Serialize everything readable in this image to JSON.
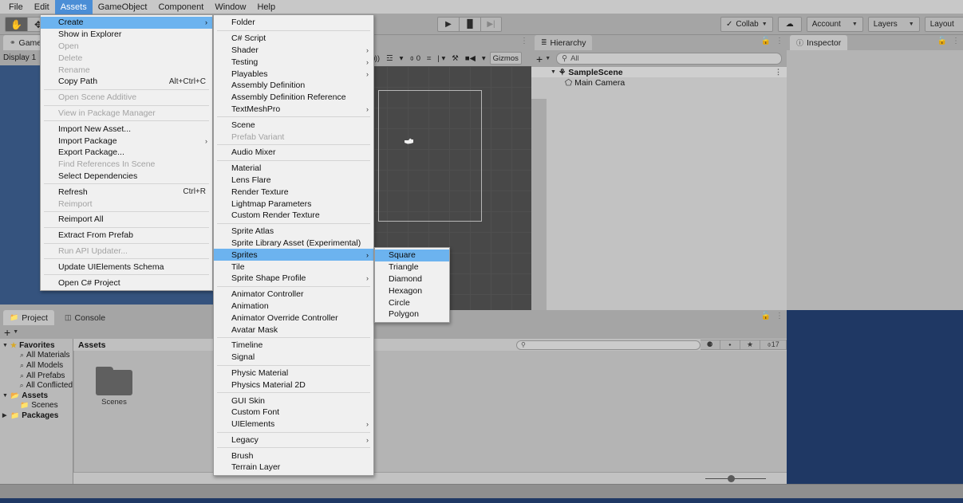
{
  "menubar": {
    "items": [
      {
        "label": "File",
        "active": false
      },
      {
        "label": "Edit",
        "active": false
      },
      {
        "label": "Assets",
        "active": true
      },
      {
        "label": "GameObject",
        "active": false
      },
      {
        "label": "Component",
        "active": false
      },
      {
        "label": "Window",
        "active": false
      },
      {
        "label": "Help",
        "active": false
      }
    ]
  },
  "toolbar": {
    "tools": [
      {
        "name": "hand-tool",
        "glyph": "✋"
      },
      {
        "name": "move-tool",
        "glyph": "✥"
      }
    ],
    "play_controls": [
      {
        "name": "play-button",
        "glyph": "▶"
      },
      {
        "name": "pause-button",
        "glyph": "▐▌"
      },
      {
        "name": "step-button",
        "glyph": "▶|"
      }
    ],
    "collab_label": "Collab",
    "cloud_icon": "cloud-icon",
    "account_label": "Account",
    "layers_label": "Layers",
    "layout_label": "Layout"
  },
  "game_view": {
    "tab_label": "Game",
    "tab_icon": "game-icon",
    "display_label": "Display 1",
    "canvas_color": "#35537e"
  },
  "scene_view": {
    "tools": [
      {
        "name": "audio-toggle-icon",
        "label": "◂))"
      },
      {
        "name": "fx-lighting-icon",
        "label": "☲"
      },
      {
        "name": "fx-dropdown-caret",
        "label": "▾"
      },
      {
        "name": "gizmo-visibility-icon",
        "label": "⌽ 0"
      },
      {
        "name": "grid-icon",
        "label": "⌗"
      },
      {
        "name": "grid-caret",
        "label": "| ▾"
      },
      {
        "name": "scene-tools-icon",
        "label": "⚒"
      },
      {
        "name": "camera-icon",
        "label": "■◀"
      },
      {
        "name": "camera-caret",
        "label": "▾"
      },
      {
        "name": "gizmos-button",
        "label": "Gizmos"
      }
    ]
  },
  "hierarchy": {
    "tab_label": "Hierarchy",
    "tab_icon": "hierarchy-icon",
    "add_button": "+",
    "search_placeholder": "All",
    "search_icon": "search-icon",
    "tree": [
      {
        "label": "SampleScene",
        "type": "scene",
        "expanded": true,
        "icon": "scene-icon"
      },
      {
        "label": "Main Camera",
        "type": "gameobject",
        "icon": "gameobject-icon"
      }
    ]
  },
  "inspector": {
    "tab_label": "Inspector",
    "tab_icon": "info-icon"
  },
  "project": {
    "tabs": [
      {
        "label": "Project",
        "icon": "folder-icon",
        "active": true
      },
      {
        "label": "Console",
        "icon": "console-icon",
        "active": false
      }
    ],
    "add_button": "+",
    "tree": [
      {
        "label": "Favorites",
        "icon": "star-icon",
        "bold": true,
        "indent": 0,
        "arrow": "▼"
      },
      {
        "label": "All Materials",
        "icon": "search-icon",
        "bold": false,
        "indent": 1,
        "arrow": ""
      },
      {
        "label": "All Models",
        "icon": "search-icon",
        "bold": false,
        "indent": 1,
        "arrow": ""
      },
      {
        "label": "All Prefabs",
        "icon": "search-icon",
        "bold": false,
        "indent": 1,
        "arrow": ""
      },
      {
        "label": "All Conflicted",
        "icon": "search-icon",
        "bold": false,
        "indent": 1,
        "arrow": ""
      },
      {
        "label": "Assets",
        "icon": "folder-open-icon",
        "bold": true,
        "indent": 0,
        "arrow": "▼"
      },
      {
        "label": "Scenes",
        "icon": "folder-icon",
        "bold": false,
        "indent": 1,
        "arrow": ""
      },
      {
        "label": "Packages",
        "icon": "folder-icon",
        "bold": true,
        "indent": 0,
        "arrow": "▶"
      }
    ],
    "breadcrumb": "Assets",
    "search_placeholder": "",
    "search_icon": "search-icon",
    "filter_buttons": [
      {
        "name": "filter-by-type-icon",
        "label": "⚈"
      },
      {
        "name": "filter-by-label-icon",
        "label": "⬩"
      },
      {
        "name": "filter-favorite-icon",
        "label": "★"
      },
      {
        "name": "hidden-packages-count",
        "label": "⌽17"
      }
    ],
    "assets": [
      {
        "label": "Scenes",
        "type": "folder"
      }
    ],
    "zoom_value": 37
  },
  "menu_assets": {
    "title": "Assets",
    "items": [
      {
        "label": "Create",
        "selected": true,
        "submenu": true
      },
      {
        "label": "Show in Explorer"
      },
      {
        "label": "Open",
        "disabled": true
      },
      {
        "label": "Delete",
        "disabled": true
      },
      {
        "label": "Rename",
        "disabled": true
      },
      {
        "label": "Copy Path",
        "shortcut": "Alt+Ctrl+C"
      },
      {
        "separator": true
      },
      {
        "label": "Open Scene Additive",
        "disabled": true
      },
      {
        "separator": true
      },
      {
        "label": "View in Package Manager",
        "disabled": true
      },
      {
        "separator": true
      },
      {
        "label": "Import New Asset..."
      },
      {
        "label": "Import Package",
        "submenu": true
      },
      {
        "label": "Export Package..."
      },
      {
        "label": "Find References In Scene",
        "disabled": true
      },
      {
        "label": "Select Dependencies"
      },
      {
        "separator": true
      },
      {
        "label": "Refresh",
        "shortcut": "Ctrl+R"
      },
      {
        "label": "Reimport",
        "disabled": true
      },
      {
        "separator": true
      },
      {
        "label": "Reimport All"
      },
      {
        "separator": true
      },
      {
        "label": "Extract From Prefab"
      },
      {
        "separator": true
      },
      {
        "label": "Run API Updater...",
        "disabled": true
      },
      {
        "separator": true
      },
      {
        "label": "Update UIElements Schema"
      },
      {
        "separator": true
      },
      {
        "label": "Open C# Project"
      }
    ]
  },
  "menu_create": {
    "title": "Create",
    "items": [
      {
        "label": "Folder"
      },
      {
        "separator": true
      },
      {
        "label": "C# Script"
      },
      {
        "label": "Shader",
        "submenu": true
      },
      {
        "label": "Testing",
        "submenu": true
      },
      {
        "label": "Playables",
        "submenu": true
      },
      {
        "label": "Assembly Definition"
      },
      {
        "label": "Assembly Definition Reference"
      },
      {
        "label": "TextMeshPro",
        "submenu": true
      },
      {
        "separator": true
      },
      {
        "label": "Scene"
      },
      {
        "label": "Prefab Variant",
        "disabled": true
      },
      {
        "separator": true
      },
      {
        "label": "Audio Mixer"
      },
      {
        "separator": true
      },
      {
        "label": "Material"
      },
      {
        "label": "Lens Flare"
      },
      {
        "label": "Render Texture"
      },
      {
        "label": "Lightmap Parameters"
      },
      {
        "label": "Custom Render Texture"
      },
      {
        "separator": true
      },
      {
        "label": "Sprite Atlas"
      },
      {
        "label": "Sprite Library Asset (Experimental)"
      },
      {
        "label": "Sprites",
        "selected": true,
        "submenu": true
      },
      {
        "label": "Tile"
      },
      {
        "label": "Sprite Shape Profile",
        "submenu": true
      },
      {
        "separator": true
      },
      {
        "label": "Animator Controller"
      },
      {
        "label": "Animation"
      },
      {
        "label": "Animator Override Controller"
      },
      {
        "label": "Avatar Mask"
      },
      {
        "separator": true
      },
      {
        "label": "Timeline"
      },
      {
        "label": "Signal"
      },
      {
        "separator": true
      },
      {
        "label": "Physic Material"
      },
      {
        "label": "Physics Material 2D"
      },
      {
        "separator": true
      },
      {
        "label": "GUI Skin"
      },
      {
        "label": "Custom Font"
      },
      {
        "label": "UIElements",
        "submenu": true
      },
      {
        "separator": true
      },
      {
        "label": "Legacy",
        "submenu": true
      },
      {
        "separator": true
      },
      {
        "label": "Brush"
      },
      {
        "label": "Terrain Layer"
      }
    ]
  },
  "menu_sprites": {
    "title": "Sprites",
    "items": [
      {
        "label": "Square",
        "selected": true
      },
      {
        "label": "Triangle"
      },
      {
        "label": "Diamond"
      },
      {
        "label": "Hexagon"
      },
      {
        "label": "Circle"
      },
      {
        "label": "Polygon"
      }
    ]
  },
  "colors": {
    "menu_highlight": "#6cb3ef",
    "menu_bg": "#f0f0f0",
    "panel_bg": "#a5a5a5",
    "game_bg": "#35537e",
    "scene_bg": "#484848",
    "window_border": "#1f3864"
  }
}
